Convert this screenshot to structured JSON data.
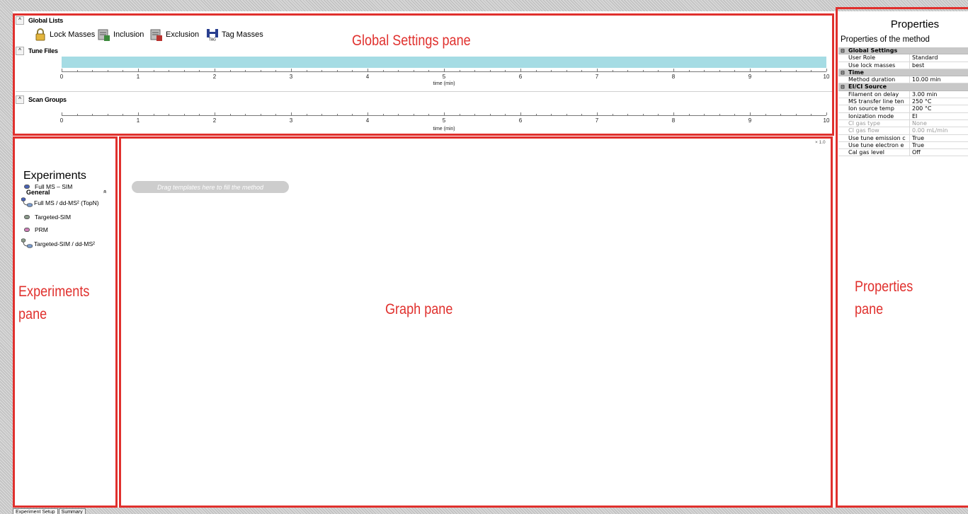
{
  "global_settings": {
    "global_lists_label": "Global Lists",
    "list_buttons": [
      {
        "label": "Lock Masses",
        "icon": "lock-icon"
      },
      {
        "label": "Inclusion",
        "icon": "inclusion-list-icon"
      },
      {
        "label": "Exclusion",
        "icon": "exclusion-list-icon"
      },
      {
        "label": "Tag Masses",
        "icon": "tag-masses-icon"
      }
    ],
    "tune_files_label": "Tune Files",
    "scan_groups_label": "Scan Groups",
    "time_axis": {
      "ticks": [
        "0",
        "1",
        "2",
        "3",
        "4",
        "5",
        "6",
        "7",
        "8",
        "9",
        "10"
      ],
      "title": "time (min)"
    }
  },
  "experiments": {
    "title": "Experiments",
    "group": "General",
    "collapse_glyph": "»",
    "items": [
      "Full MS – SIM",
      "Full MS / dd-MS² (TopN)",
      "Targeted-SIM",
      "PRM",
      "Targeted-SIM / dd-MS²"
    ]
  },
  "graph": {
    "drag_hint": "Drag templates here to fill the method",
    "zoom": "× 1.0"
  },
  "properties": {
    "title": "Properties",
    "subtitle": "Properties of the method",
    "categories": [
      {
        "name": "Global Settings",
        "rows": [
          {
            "name": "User Role",
            "value": "Standard"
          },
          {
            "name": "Use lock masses",
            "value": "best"
          }
        ]
      },
      {
        "name": "Time",
        "rows": [
          {
            "name": "Method duration",
            "value": "10.00 min"
          }
        ]
      },
      {
        "name": "EI/CI Source",
        "rows": [
          {
            "name": "Filament on delay",
            "value": "3.00 min"
          },
          {
            "name": "MS transfer line ten",
            "value": "250 °C"
          },
          {
            "name": "Ion source temp",
            "value": "200 °C"
          },
          {
            "name": "Ionization mode",
            "value": "EI"
          },
          {
            "name": "CI gas type",
            "value": "None"
          },
          {
            "name": "CI gas flow",
            "value": "0.00 mL/min"
          },
          {
            "name": "Use tune emission c",
            "value": "True"
          },
          {
            "name": "Use tune electron e",
            "value": "True"
          },
          {
            "name": "Cal gas level",
            "value": "Off"
          }
        ]
      }
    ]
  },
  "annotations": {
    "global_settings": "Global Settings pane",
    "experiments_line1": "Experiments",
    "experiments_line2": "pane",
    "graph": "Graph pane",
    "properties_line1": "Properties",
    "properties_line2": "pane"
  },
  "tabs": [
    "Experiment Setup",
    "Summary"
  ],
  "colors": {
    "callout": "#e0302d",
    "tune_bar": "#a5dce4",
    "category_bg": "#c8c8c8"
  }
}
